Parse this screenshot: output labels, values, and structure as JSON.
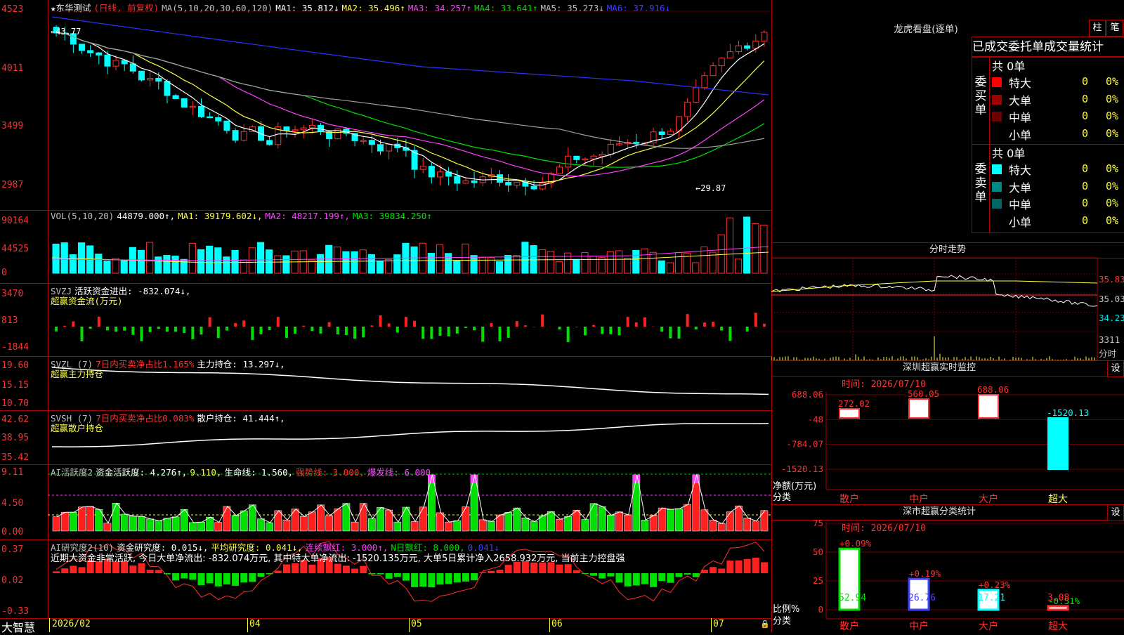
{
  "main": {
    "title": "★东华测试",
    "mode": "(日线, 前复权)",
    "ma_label": "MA(5,10,20,30,60,120)",
    "ma_values": [
      {
        "label": "MA1:",
        "value": "35.812↓",
        "color": "#ffffff"
      },
      {
        "label": "MA2:",
        "value": "35.496↑",
        "color": "#ffff40"
      },
      {
        "label": "MA3:",
        "value": "34.257↑",
        "color": "#ff40ff"
      },
      {
        "label": "MA4:",
        "value": "33.641↑",
        "color": "#00e000"
      },
      {
        "label": "MA5:",
        "value": "35.273↓",
        "color": "#c0c0c0"
      },
      {
        "label": "MA6:",
        "value": "37.916↓",
        "color": "#4040ff"
      }
    ],
    "y_ticks": [
      "4523",
      "4011",
      "3499",
      "2987"
    ],
    "high_label": "43.77",
    "low_label": "29.87"
  },
  "vol": {
    "label": "VOL(5,10,20)",
    "value": "44879.000↑,",
    "ma1": "MA1: 39179.602↓,",
    "ma2": "MA2: 48217.199↑,",
    "ma3": "MA3: 39834.250↑",
    "y_ticks": [
      "90164",
      "44525",
      "0"
    ]
  },
  "svzj": {
    "label": "SVZJ",
    "desc": "活跃资金进出: -832.074↓,",
    "sub": "超赢资金流(万元)",
    "y_ticks": [
      "3470",
      "813",
      "-1844"
    ]
  },
  "svzl": {
    "label": "SVZL (7)",
    "ratio": "7日内买卖净占比1.165%",
    "hold": "主力持仓: 13.297↓,",
    "sub": "超赢主力持仓",
    "y_ticks": [
      "19.60",
      "15.15",
      "10.70"
    ]
  },
  "svsh": {
    "label": "SVSH (7)",
    "ratio": "7日内买卖净占比0.083%",
    "hold": "散户持仓: 41.444↑,",
    "sub": "超赢散户持仓",
    "y_ticks": [
      "42.62",
      "38.95",
      "35.42"
    ]
  },
  "ai_active": {
    "label": "AI活跃度2",
    "a": "资金活跃度: 4.276↑,",
    "b": "9.110,",
    "c": "生命线: 1.560,",
    "d": "强势线: 3.000,",
    "e": "爆发线: 6.000,",
    "y_ticks": [
      "9.11",
      "4.50",
      "0.00"
    ]
  },
  "ai_research": {
    "label": "AI研究度2(10)",
    "a": "资金研究度: 0.015↓,",
    "b": "平均研究度: 0.041↓,",
    "c": "连续飘红: 3.000↑,",
    "d": "N日飘红: 8.000,",
    "e": "0.041↓",
    "note": "近期大资金非常活跃, 今日大单净流出: -832.074万元, 其中特大单净流出: -1520.135万元, 大单5日累计净入2658.932万元, 当前主力控盘强",
    "y_ticks": [
      "0.37",
      "0.02",
      "-0.33"
    ]
  },
  "bottom": {
    "brand": "大智慧",
    "months": [
      "2026/02",
      "04",
      "05",
      "06",
      "07"
    ]
  },
  "dragon": {
    "title": "龙虎看盘(逐单)",
    "btn1": "柱",
    "btn2": "笔",
    "subtitle": "已成交委托单成交量统计",
    "buy_label": "委买单",
    "sell_label": "委卖单",
    "buy_total": "共 0单",
    "sell_total": "共 0单",
    "buy_rows": [
      {
        "name": "特大",
        "count": "0",
        "pct": "0%",
        "color": "#ff0000"
      },
      {
        "name": "大单",
        "count": "0",
        "pct": "0%",
        "color": "#a00000"
      },
      {
        "name": "中单",
        "count": "0",
        "pct": "0%",
        "color": "#700000"
      },
      {
        "name": "小单",
        "count": "0",
        "pct": "0%",
        "color": "#000000"
      }
    ],
    "sell_rows": [
      {
        "name": "特大",
        "count": "0",
        "pct": "0%",
        "color": "#00ffff"
      },
      {
        "name": "大单",
        "count": "0",
        "pct": "0%",
        "color": "#008888"
      },
      {
        "name": "中单",
        "count": "0",
        "pct": "0%",
        "color": "#006666"
      },
      {
        "name": "小单",
        "count": "0",
        "pct": "0%",
        "color": "#000000"
      }
    ]
  },
  "intraday": {
    "title": "分时走势",
    "prices": [
      "35.83",
      "35.03",
      "34.23"
    ],
    "vol": "3311",
    "vol_unit": "分时"
  },
  "sz_monitor": {
    "title": "深圳超赢实时监控",
    "btn": "设",
    "time": "时间: 2026/07/10",
    "y_ticks": [
      "688.06",
      "-48",
      "-784.07",
      "-1520.13"
    ],
    "ylabel": "净额(万元)",
    "xlabel": "分类",
    "categories": [
      "散户",
      "中户",
      "大户",
      "超大"
    ],
    "values": [
      "272.02",
      "560.05",
      "688.06",
      "-1520.13"
    ]
  },
  "sz_class": {
    "title": "深市超赢分类统计",
    "btn": "设",
    "time": "时间: 2026/07/10",
    "y_ticks": [
      "75",
      "50",
      "25",
      "0"
    ],
    "ylabel": "比例%",
    "xlabel": "分类",
    "categories": [
      "散户",
      "中户",
      "大户",
      "超大"
    ],
    "values": [
      "52.94",
      "26.76",
      "17.21",
      "3.08"
    ],
    "changes": [
      "+0.09%",
      "+0.19%",
      "+0.23%",
      "-0.51%"
    ]
  },
  "chart_data": {
    "type": "bar",
    "title": "深圳超赢实时监控",
    "categories": [
      "散户",
      "中户",
      "大户",
      "超大"
    ],
    "values": [
      272.02,
      560.05,
      688.06,
      -1520.13
    ],
    "ylabel": "净额(万元)",
    "ylim": [
      -1520.13,
      688.06
    ]
  }
}
